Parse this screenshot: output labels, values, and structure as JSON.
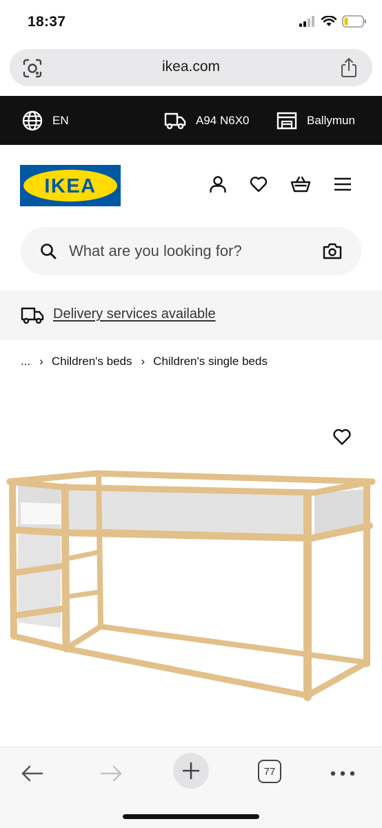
{
  "status_bar": {
    "time": "18:37"
  },
  "browser": {
    "url": "ikea.com",
    "tab_count": "77"
  },
  "top_strip": {
    "language": "EN",
    "postcode": "A94 N6X0",
    "store": "Ballymun"
  },
  "header": {
    "logo_text": "IKEA"
  },
  "search": {
    "placeholder": "What are you looking for?"
  },
  "delivery": {
    "link_text": "Delivery services available"
  },
  "breadcrumb": {
    "ellipsis": "...",
    "items": [
      "Children's beds",
      "Children's single beds"
    ],
    "separator": "›"
  },
  "icons": {
    "lens": "lens-icon",
    "share": "share-icon",
    "globe": "globe-icon",
    "truck": "truck-icon",
    "store": "store-icon",
    "user": "user-icon",
    "heart": "heart-icon",
    "basket": "basket-icon",
    "menu": "menu-icon",
    "search": "search-icon",
    "camera": "camera-icon"
  },
  "colors": {
    "ikea_blue": "#0058a3",
    "ikea_yellow": "#ffdb00",
    "strip_bg": "#111111",
    "pine": "#e2c08a"
  }
}
